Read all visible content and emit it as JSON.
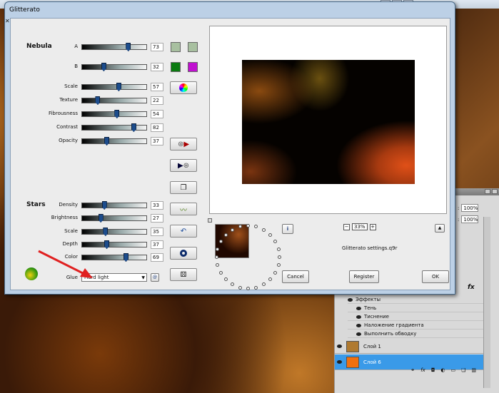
{
  "dialog": {
    "title": "Glitterato",
    "close_glyph": "✕",
    "sections": {
      "nebula": "Nebula",
      "stars": "Stars"
    },
    "nebula_ab": [
      {
        "label": "A",
        "value": "73",
        "level": 0.73
      },
      {
        "label": "B",
        "value": "32",
        "level": 0.32
      }
    ],
    "nebula_sliders": [
      {
        "label": "Scale",
        "value": "57",
        "level": 0.57
      },
      {
        "label": "Texture",
        "value": "22",
        "level": 0.22
      },
      {
        "label": "Fibrousness",
        "value": "54",
        "level": 0.54
      },
      {
        "label": "Contrast",
        "value": "82",
        "level": 0.82
      },
      {
        "label": "Opacity",
        "value": "37",
        "level": 0.37
      }
    ],
    "star_sliders": [
      {
        "label": "Density",
        "value": "33",
        "level": 0.33
      },
      {
        "label": "Brightness",
        "value": "27",
        "level": 0.27
      },
      {
        "label": "Scale",
        "value": "35",
        "level": 0.35
      },
      {
        "label": "Depth",
        "value": "37",
        "level": 0.37
      },
      {
        "label": "Color",
        "value": "69",
        "level": 0.69
      }
    ],
    "glue": {
      "label": "Glue",
      "value": "Hard light"
    },
    "swatch_colors": [
      "#a8c0a0",
      "#a8c0a0",
      "#0a7a10",
      "#c010d0"
    ],
    "icon_buttons": [
      "color-wheel-icon",
      "play-preset-icon",
      "apply-preset-icon",
      "copy-icon",
      "wave-icon",
      "undo-icon",
      "ring-icon",
      "dice-icon"
    ],
    "zoom": "33%",
    "settings_file": "Glitterato settings.q9r",
    "buttons": {
      "cancel": "Cancel",
      "register": "Register",
      "ok": "OK"
    },
    "info_glyph": "i"
  },
  "layers_panel": {
    "opacity_labels": [
      "100%",
      "100%"
    ],
    "fx_label": "fx",
    "effects_header": "Эффекты",
    "effects": [
      "Тень",
      "Тиснение",
      "Наложение градиента",
      "Выполнить обводку"
    ],
    "layers": [
      {
        "name": "Слой 1",
        "color": "#b07a30"
      },
      {
        "name": "Слой 6",
        "color": "#f07010"
      }
    ]
  },
  "accent_colors": {
    "selection": "#3a9ae8",
    "arrow": "#e02020"
  }
}
